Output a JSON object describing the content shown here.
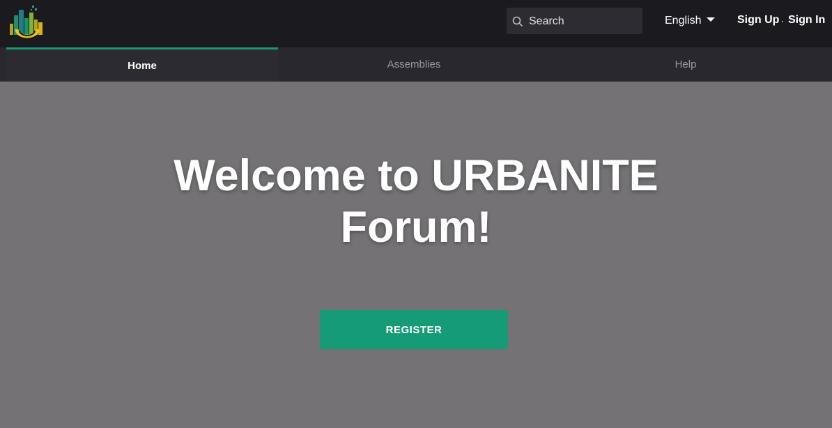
{
  "header": {
    "search_placeholder": "Search",
    "language": "English",
    "signup_label": "Sign Up",
    "signin_label": "Sign In"
  },
  "nav": {
    "tabs": [
      {
        "label": "Home",
        "active": true
      },
      {
        "label": "Assemblies",
        "active": false
      },
      {
        "label": "Help",
        "active": false
      }
    ]
  },
  "hero": {
    "title": "Welcome to URBANITE Forum!",
    "register_label": "REGISTER"
  },
  "colors": {
    "topbar": "#1b1a1f",
    "nav": "#29282e",
    "accent": "#159b76",
    "hero_bg": "#747275"
  },
  "icons": {
    "logo": "urbanite-logo",
    "search": "search-icon",
    "language_caret": "caret-down-icon"
  }
}
